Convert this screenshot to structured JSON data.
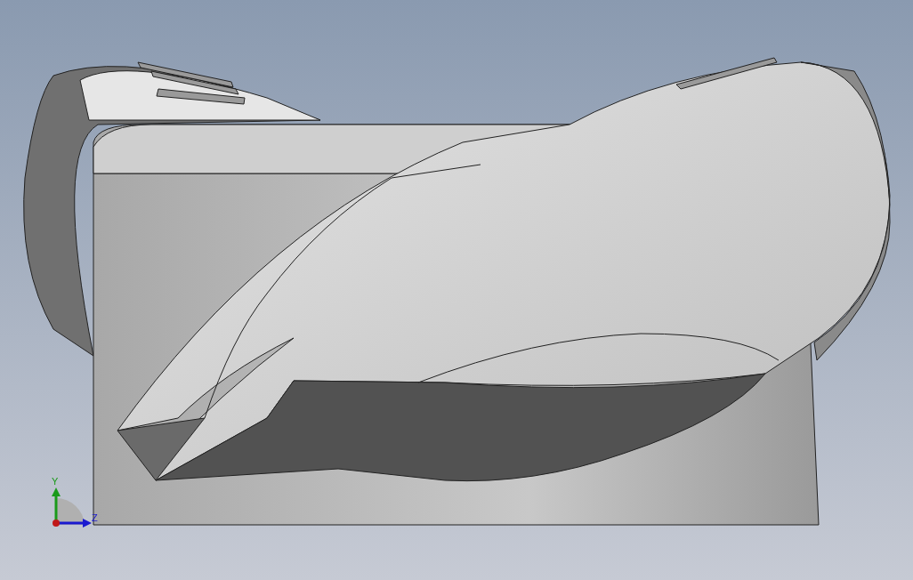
{
  "viewport": {
    "triad": {
      "axes": [
        {
          "kind": "vertical",
          "label": "Y",
          "color": "#1a9a1a"
        },
        {
          "kind": "horizontal",
          "label": "Z",
          "color": "#1a1ad0"
        }
      ]
    }
  }
}
